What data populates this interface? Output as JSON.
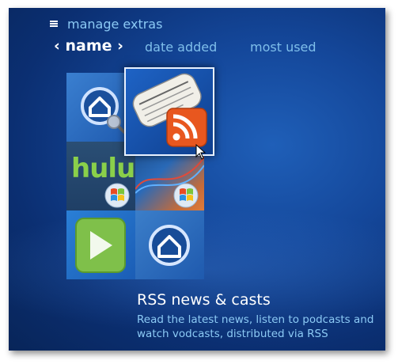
{
  "header": {
    "title": "manage extras",
    "sort_current": "name",
    "sort_options": [
      "date added",
      "most used"
    ]
  },
  "tiles": [
    {
      "name": "home-server-1",
      "icon": "home-search-icon"
    },
    {
      "name": "rss-news",
      "icon": "rss-icon"
    },
    {
      "name": "hulu",
      "label": "hulu",
      "icon": "windows-logo-icon"
    },
    {
      "name": "unknown-extra",
      "icon": "windows-logo-icon"
    },
    {
      "name": "play",
      "icon": "play-icon"
    },
    {
      "name": "home-server-2",
      "icon": "home-icon"
    }
  ],
  "details": {
    "title": "RSS news & casts",
    "description": "Read the latest news, listen to podcasts and watch vodcasts, distributed via RSS"
  },
  "colors": {
    "accent": "#8ccaf5",
    "background": "#14479a",
    "hulu_green": "#8ad04a",
    "rss_orange": "#e8571f"
  }
}
